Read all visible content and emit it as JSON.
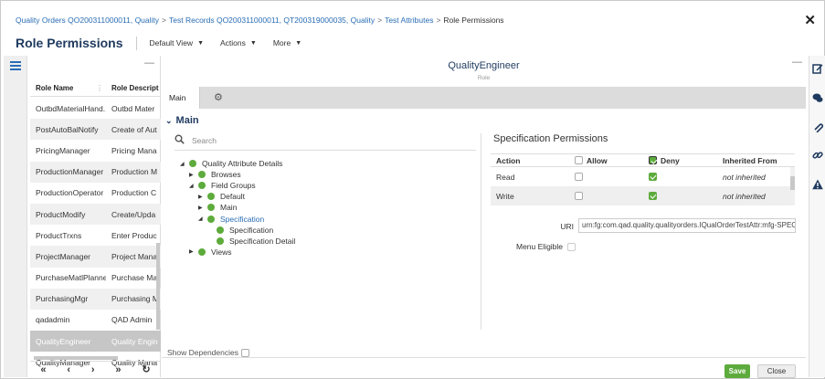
{
  "breadcrumb": [
    {
      "label": "Quality Orders QO200311000011, Quality"
    },
    {
      "label": "Test Records QO200311000011, QT200319000035, Quality"
    },
    {
      "label": "Test Attributes"
    },
    {
      "label": "Role Permissions"
    }
  ],
  "header": {
    "title": "Role Permissions",
    "menus": [
      "Default View",
      "Actions",
      "More"
    ]
  },
  "role_list": {
    "columns": [
      "Role Name",
      "Role Descript"
    ],
    "rows": [
      {
        "name": "OutbdMaterialHand...",
        "desc": "Outbd Mater"
      },
      {
        "name": "PostAutoBalNotify",
        "desc": "Create of Aut"
      },
      {
        "name": "PricingManager",
        "desc": "Pricing Mana"
      },
      {
        "name": "ProductionManager",
        "desc": "Production M"
      },
      {
        "name": "ProductionOperator",
        "desc": "Production C"
      },
      {
        "name": "ProductModify",
        "desc": "Create/Upda"
      },
      {
        "name": "ProductTrxns",
        "desc": "Enter Produc"
      },
      {
        "name": "ProjectManager",
        "desc": "Project Mana"
      },
      {
        "name": "PurchaseMatlPlanner",
        "desc": "Purchase Mat"
      },
      {
        "name": "PurchasingMgr",
        "desc": "Purchasing M"
      },
      {
        "name": "qadadmin",
        "desc": "QAD Admin"
      },
      {
        "name": "QualityEngineer",
        "desc": "Quality Engin"
      },
      {
        "name": "QualityManager",
        "desc": "Quality Mana"
      }
    ],
    "selected_index": 11,
    "pager": [
      "«",
      "‹",
      "›",
      "»",
      "↻"
    ]
  },
  "main": {
    "role_title": "QualityEngineer",
    "role_subtitle": "Role",
    "tab_label": "Main",
    "section_label": "Main",
    "search_placeholder": "Search",
    "tree": [
      {
        "label": "Quality Attribute Details",
        "depth": 0,
        "arrow": "◢"
      },
      {
        "label": "Browses",
        "depth": 1,
        "arrow": "▶"
      },
      {
        "label": "Field Groups",
        "depth": 1,
        "arrow": "◢"
      },
      {
        "label": "Default",
        "depth": 2,
        "arrow": "▶"
      },
      {
        "label": "Main",
        "depth": 2,
        "arrow": "▶"
      },
      {
        "label": "Specification",
        "depth": 2,
        "arrow": "◢",
        "active": true
      },
      {
        "label": "Specification",
        "depth": 3,
        "arrow": ""
      },
      {
        "label": "Specification Detail",
        "depth": 3,
        "arrow": ""
      },
      {
        "label": "Views",
        "depth": 1,
        "arrow": "▶"
      }
    ],
    "show_dependencies_label": "Show Dependencies"
  },
  "spec": {
    "title": "Specification Permissions",
    "columns": {
      "action": "Action",
      "allow": "Allow",
      "deny": "Deny",
      "inherited": "Inherited From"
    },
    "rows": [
      {
        "action": "Read",
        "allow": false,
        "deny": true,
        "inherited": "not inherited"
      },
      {
        "action": "Write",
        "allow": false,
        "deny": true,
        "inherited": "not inherited"
      }
    ],
    "uri_label": "URI",
    "uri_value": "urn:fg:com.qad.quality.qualityorders.IQualOrderTestAttr:mfg-SPECIF",
    "menu_eligible_label": "Menu Eligible"
  },
  "footer": {
    "save_label": "Save",
    "close_label": "Close"
  },
  "colors": {
    "accent": "#2a6db5",
    "title": "#1f3a5f",
    "green": "#5dab3c"
  },
  "icons": {
    "close": "close-icon",
    "list": "list-icon",
    "gear": "gear-icon",
    "search": "search-icon",
    "refresh": "refresh-icon"
  }
}
